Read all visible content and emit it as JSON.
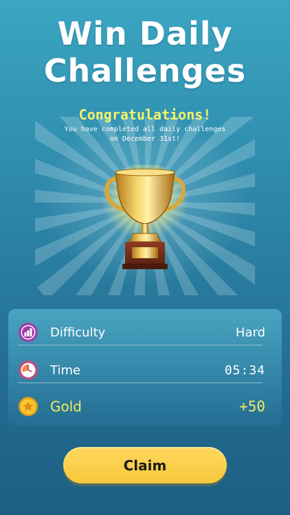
{
  "header": {
    "title_line1": "Win Daily",
    "title_line2": "Challenges"
  },
  "result": {
    "heading": "Congratulations!",
    "message_line1": "You have completed all daily challenges",
    "message_line2": "on December 31st!",
    "trophy_icon": "trophy-icon"
  },
  "stats": [
    {
      "icon": "difficulty-bars-icon",
      "label": "Difficulty",
      "value": "Hard"
    },
    {
      "icon": "clock-icon",
      "label": "Time",
      "value": "05:34"
    },
    {
      "icon": "gold-star-coin-icon",
      "label": "Gold",
      "value": "+50"
    }
  ],
  "colors": {
    "accent_yellow": "#f2ea62",
    "button": "#f6c83b",
    "difficulty_icon": "#9b3fa8",
    "clock_icon": "#c24a86",
    "coin": "#f4b31b"
  },
  "actions": {
    "claim_label": "Claim"
  }
}
